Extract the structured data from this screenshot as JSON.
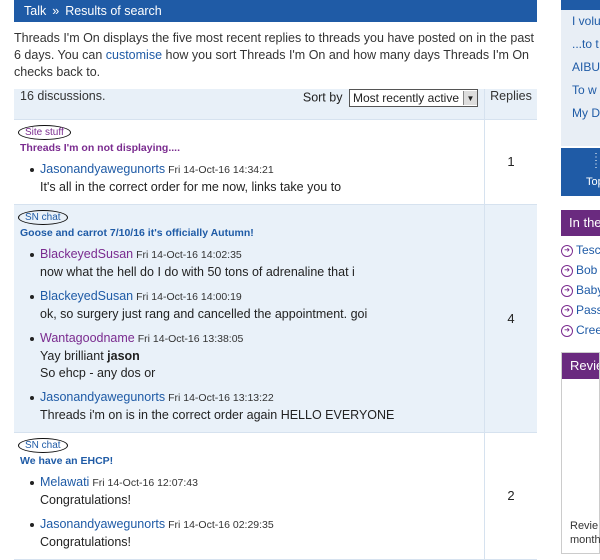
{
  "breadcrumb": {
    "root": "Talk",
    "separator": "»",
    "current": "Results of search"
  },
  "intro": {
    "part1": "Threads I'm On displays the five most recent replies to threads you have posted on in the past 6 days. You can ",
    "link": "customise",
    "part2": " how you sort Threads I'm On and how many days Threads I'm On checks back to."
  },
  "table": {
    "count": "16 discussions.",
    "sort_label": "Sort by",
    "sort_value": "Most recently active",
    "replies_header": "Replies",
    "threads": [
      {
        "topic": "Site stuff",
        "title": "Threads I'm on not displaying....",
        "replies": "1",
        "posts": [
          {
            "author": "Jasonandyawegunorts",
            "time": "Fri 14-Oct-16 14:34:21",
            "snippet": "It's all in the correct order for me now, links take you to"
          }
        ]
      },
      {
        "topic": "SN chat",
        "title": "Goose and carrot 7/10/16 it's officially Autumn!",
        "replies": "4",
        "posts": [
          {
            "author": "BlackeyedSusan",
            "time": "Fri 14-Oct-16 14:02:35",
            "snippet": "now what the hell do I do with 50 tons of adrenaline that i"
          },
          {
            "author": "BlackeyedSusan",
            "time": "Fri 14-Oct-16 14:00:19",
            "snippet": "ok, so surgery just rang and cancelled the appointment. goi"
          },
          {
            "author": "Wantagoodname",
            "time": "Fri 14-Oct-16 13:38:05",
            "snippet_a": "Yay brilliant ",
            "snippet_b": "jason",
            "snippet_c": "So ehcp - any dos or"
          },
          {
            "author": "Jasonandyawegunorts",
            "time": "Fri 14-Oct-16 13:13:22",
            "snippet": "Threads i'm on is in the correct order again HELLO EVERYONE"
          }
        ]
      },
      {
        "topic": "SN chat",
        "title": "We have an EHCP!",
        "replies": "2",
        "posts": [
          {
            "author": "Melawati",
            "time": "Fri 14-Oct-16 12:07:43",
            "snippet": "Congratulations!"
          },
          {
            "author": "Jasonandyawegunorts",
            "time": "Fri 14-Oct-16 02:29:35",
            "snippet": "Congratulations!"
          }
        ]
      }
    ]
  },
  "sidebar": {
    "links": [
      "I volu",
      "...to t",
      "AIBU",
      "To w",
      "My D"
    ],
    "blue_label": "Top",
    "purple_header": "In the",
    "list": [
      "Tesc",
      "Bob",
      "Baby",
      "Pass",
      "Cree"
    ],
    "review_header": "Revie",
    "review_footer_1": "Revie",
    "review_footer_2": "month"
  },
  "colors": {
    "brand_blue": "#1f5ba6",
    "brand_purple": "#6a2a7f",
    "row_alt": "#e9f1f9"
  }
}
